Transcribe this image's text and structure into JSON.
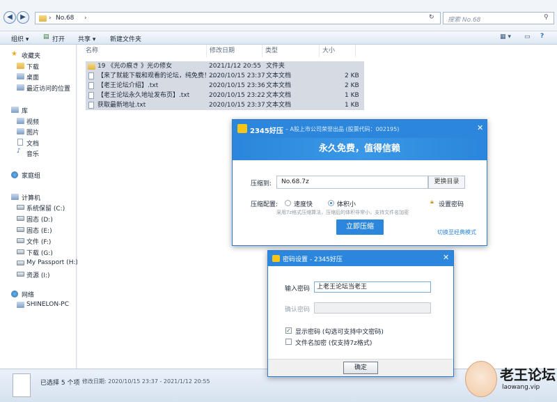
{
  "explorer": {
    "breadcrumb_sep": "›",
    "path": "No.68",
    "search_placeholder": "搜索 No.68",
    "toolbar": {
      "organize": "组织 ▾",
      "open": "打开",
      "share": "共享 ▾",
      "new_folder": "新建文件夹"
    },
    "sidebar": {
      "favorites": "收藏夹",
      "fav_items": [
        "下载",
        "桌面",
        "最近访问的位置"
      ],
      "libraries": "库",
      "lib_items": [
        "视频",
        "图片",
        "文档",
        "音乐"
      ],
      "homegroup": "家庭组",
      "computer": "计算机",
      "drives": [
        "系统保留 (C:)",
        "固态 (D:)",
        "固态 (E:)",
        "文件 (F:)",
        "下载 (G:)",
        "My Passport (H:)",
        "资源 (I:)"
      ],
      "network": "网络",
      "net_items": [
        "SHINELON-PC"
      ]
    },
    "columns": [
      "名称",
      "修改日期",
      "类型",
      "大小"
    ],
    "files": [
      {
        "name": "19 《光の痕き 》光の修女",
        "date": "2021/1/12 20:55",
        "type": "文件夹",
        "size": "",
        "kind": "folder"
      },
      {
        "name": "【来了就能下载和观看的论坛，纯免费！...",
        "date": "2020/10/15 23:37",
        "type": "文本文档",
        "size": "2 KB",
        "kind": "file"
      },
      {
        "name": "【老王论坛介绍】.txt",
        "date": "2020/10/15 23:36",
        "type": "文本文档",
        "size": "2 KB",
        "kind": "file"
      },
      {
        "name": "【老王论坛永久地址发布页】.txt",
        "date": "2020/10/15 23:22",
        "type": "文本文档",
        "size": "1 KB",
        "kind": "file"
      },
      {
        "name": "获取最新地址.txt",
        "date": "2020/10/15 23:37",
        "type": "文本文档",
        "size": "1 KB",
        "kind": "file"
      }
    ],
    "status_selected": "已选择 5 个项",
    "status_dates": "修改日期: 2020/10/15 23:37 - 2021/1/12 20:55"
  },
  "compress_dialog": {
    "title": "2345好压",
    "subtitle": "– A股上市公司荣誉出品 (股票代码：002195)",
    "banner": "永久免费，值得信赖",
    "label_to": "压缩到:",
    "path_value": "No.68.7z",
    "change_dir": "更换目录",
    "label_config": "压缩配置:",
    "opt_fast": "速度快",
    "opt_small": "体积小",
    "set_password": "设置密码",
    "hint": "采用7z格式压缩算法，压缩后的体积非常小，支持文件名加密",
    "compress_btn": "立即压缩",
    "switch_mode": "切换至经典模式",
    "close": "✕"
  },
  "password_dialog": {
    "title": "密码设置 - 2345好压",
    "label_enter": "输入密码",
    "enter_value": "上老王论坛当老王",
    "label_confirm": "确认密码",
    "confirm_value": "",
    "show_password": "显示密码 (勾选可支持中文密码)",
    "encrypt_names": "文件名加密 (仅支持7z格式)",
    "ok": "确定",
    "close": "✕"
  },
  "watermark": {
    "title": "老王论坛",
    "url": "laowang.vip"
  },
  "colors": {
    "accent": "#2c87dc",
    "selection": "#d6dbe3",
    "link": "#2c87dc"
  }
}
